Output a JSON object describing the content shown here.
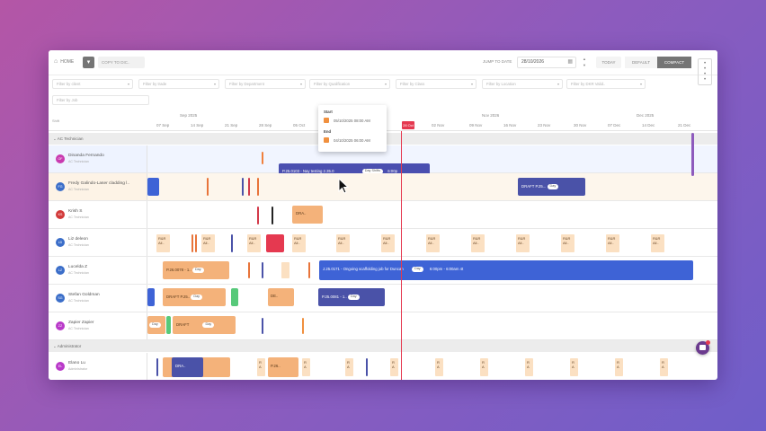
{
  "toolbar": {
    "home_label": "HOME",
    "copy_label": "COPY TO DIC..",
    "jump_label": "JUMP TO DATE",
    "jump_value": "28/10/2026",
    "today_label": "TODAY",
    "default_label": "DEFAULT",
    "compact_label": "COMPACT"
  },
  "filters": [
    "Filter by client",
    "Filter by trade",
    "Filter by Department",
    "Filter by Qualification",
    "Filter by Class",
    "Filter by Location",
    "Filter by DKR Valid..",
    "Filter by Job"
  ],
  "timeline": {
    "shift_label": "Shift",
    "months": [
      "Sep 2025",
      "Nov 2026",
      "Dec 2025"
    ],
    "days": [
      "07 Sep",
      "14 Sep",
      "21 Sep",
      "28 Sep",
      "05 Oct",
      "12 Oct",
      "19 Oct",
      "26 Oct",
      "02 Nov",
      "09 Nov",
      "16 Nov",
      "23 Nov",
      "30 Nov",
      "07 Dec",
      "14 Dec",
      "21 Dec"
    ],
    "today_label": "28 Oct"
  },
  "groups": {
    "ac": "AC Technician",
    "admin": "Administrator"
  },
  "people": [
    {
      "initials": "OF",
      "name": "Dinanda Fernando",
      "role": "AC Technician",
      "color": "#c93ab0"
    },
    {
      "initials": "FG",
      "name": "Fredy Galindo-Laser cladding l..",
      "role": "AC Technician",
      "color": "#3b6ec9"
    },
    {
      "initials": "KS",
      "name": "Krish S",
      "role": "AC Technician",
      "color": "#d23a3a"
    },
    {
      "initials": "LD",
      "name": "Liz deleon",
      "role": "AC Technician",
      "color": "#3b6ec9"
    },
    {
      "initials": "LZ",
      "name": "Lucelda Z",
      "role": "AC Technician",
      "color": "#3b6ec9"
    },
    {
      "initials": "SG",
      "name": "Stefan Goldman",
      "role": "AC Technician",
      "color": "#3b6ec9"
    },
    {
      "initials": "ZZ",
      "name": "Zapier Zapier",
      "role": "AC Technician",
      "color": "#b93ac9"
    },
    {
      "initials": "EL",
      "name": "Elano Lu",
      "role": "Administrator",
      "color": "#b93ac9"
    }
  ],
  "bars": {
    "row1_main": "P.25.0103 - Nay testing 2.35.0",
    "row1_pill": "Day Shifts",
    "row1_time": "6:00p",
    "row2_draft": "DRAFT  P.25...",
    "row2_pill": "Day",
    "row3_dra": "DRA..",
    "row5_left": "P.26.0078 - 1..",
    "row5_left_pill": "Day",
    "row5_right": "J.25.0171 - Ongoing scaffolding job for Duncan",
    "row5_right_pill": "Day",
    "row5_right_time": "6:00pm - 6:00am  4t",
    "row6_draft": "DRAFT  P.25..",
    "row6_pill": "Day",
    "row6_de": "DE..",
    "row6_p": "P.25.0081 - 1..",
    "row6_p_pill": "Day",
    "row7_pill": "Day",
    "row7_draft": "DRAFT",
    "row7_pill2": "Day",
    "row8_dra": "DRA..",
    "row8_pill": "Day",
    "row8_p": "P.26..",
    "chip_text": "R&R All..",
    "chip_short": "R A"
  },
  "popup": {
    "start_label": "Start",
    "start_value": "05/10/2025 08:00 AM",
    "end_label": "End",
    "end_value": "04/10/2025 06:00 AM"
  },
  "colors": {
    "accent_blue": "#4a4fb0",
    "orange": "#f4b27a",
    "today_red": "#e53950",
    "draft_blue": "#4a52a8"
  }
}
